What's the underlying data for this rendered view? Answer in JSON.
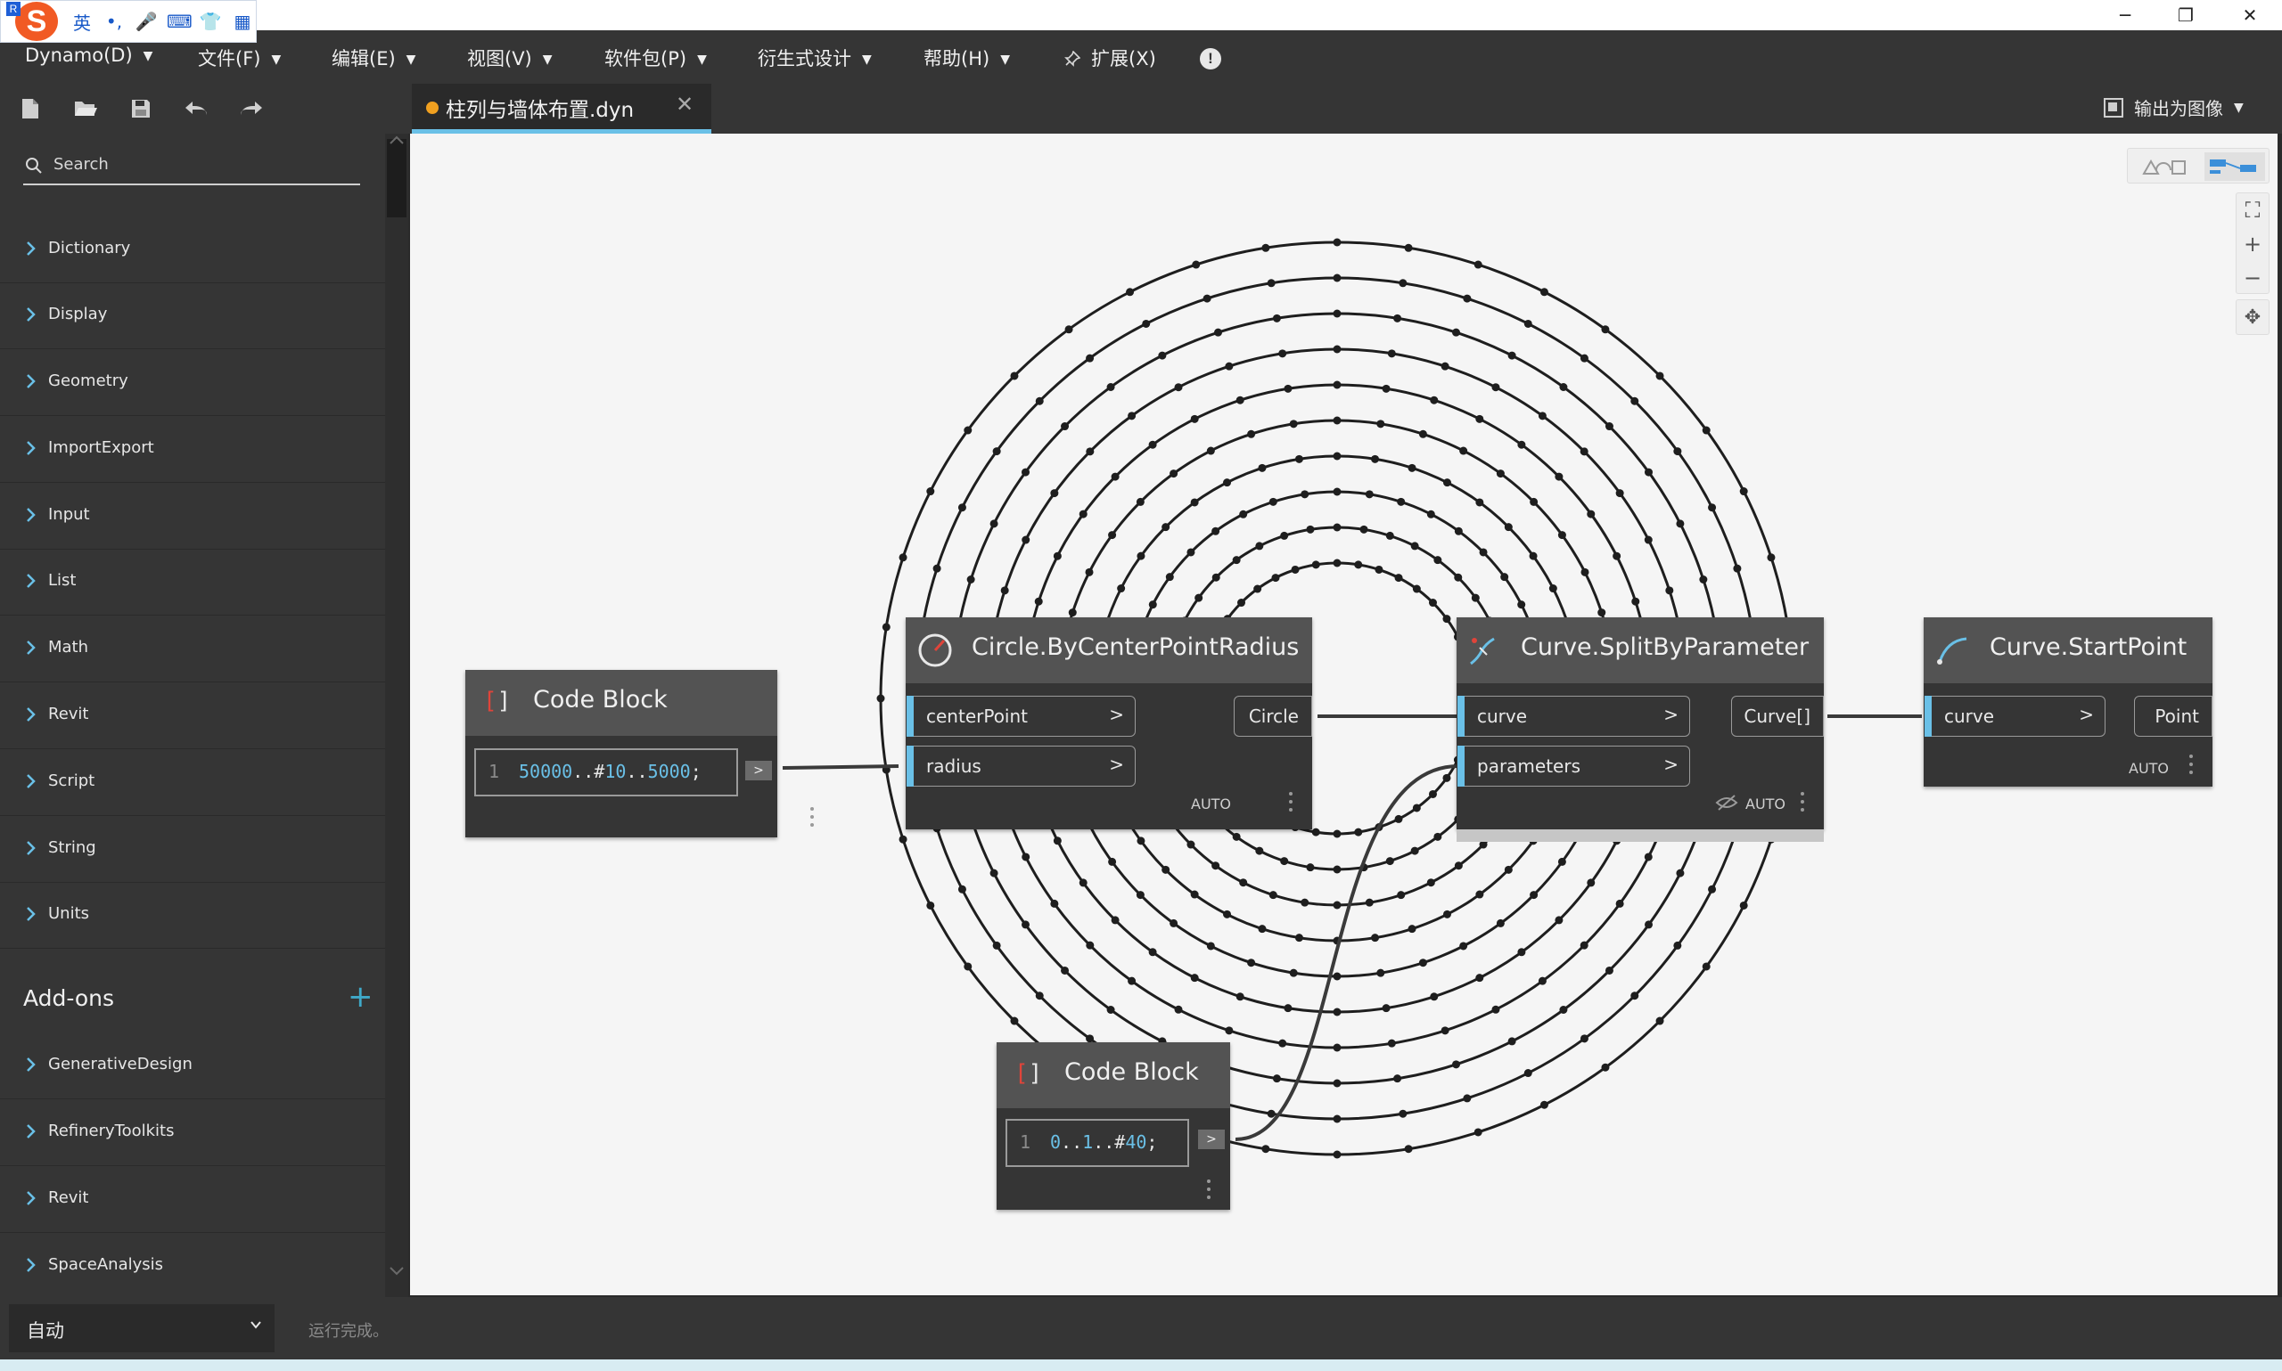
{
  "ime": {
    "logo_letter": "S",
    "badge_letter": "R",
    "tools": [
      "英",
      "•,",
      "🎤",
      "⌨",
      "👕",
      "▦"
    ]
  },
  "window": {
    "minimize": "─",
    "restore": "❐",
    "close": "✕"
  },
  "menu": [
    {
      "label": "Dynamo(D)",
      "caret": "▼"
    },
    {
      "label": "文件(F)",
      "caret": "▼"
    },
    {
      "label": "编辑(E)",
      "caret": "▼"
    },
    {
      "label": "视图(V)",
      "caret": "▼"
    },
    {
      "label": "软件包(P)",
      "caret": "▼"
    },
    {
      "label": "衍生式设计",
      "caret": "▼"
    },
    {
      "label": "帮助(H)",
      "caret": "▼"
    },
    {
      "label": "扩展(X)",
      "caret": ""
    }
  ],
  "help_icon": "!",
  "tab": {
    "label": "柱列与墙体布置.dyn",
    "close": "✕"
  },
  "export": {
    "label": "输出为图像",
    "caret": "▼"
  },
  "library": {
    "search_placeholder": "Search",
    "categories": [
      "Dictionary",
      "Display",
      "Geometry",
      "ImportExport",
      "Input",
      "List",
      "Math",
      "Revit",
      "Script",
      "String",
      "Units"
    ],
    "addons_title": "Add-ons",
    "addons_plus": "+",
    "addons": [
      "GenerativeDesign",
      "RefineryToolkits",
      "Revit",
      "SpaceAnalysis"
    ]
  },
  "zoom": {
    "fit": "⛶",
    "zoom_in": "+",
    "zoom_out": "−",
    "pan": "✥"
  },
  "nodes": {
    "code1": {
      "title": "Code Block",
      "bracket_l": "[",
      "bracket_r": "]",
      "line": "1",
      "code_a": "50000",
      "code_b": "..#",
      "code_c": "10",
      "code_d": "..",
      "code_e": "5000",
      "code_f": ";",
      "out": ">"
    },
    "circle": {
      "title": "Circle.ByCenterPointRadius",
      "in1": "centerPoint",
      "in2": "radius",
      "out": "Circle",
      "gt": ">",
      "auto": "AUTO"
    },
    "split": {
      "title": "Curve.SplitByParameter",
      "in1": "curve",
      "in2": "parameters",
      "out": "Curve[]",
      "gt": ">",
      "auto": "AUTO"
    },
    "start": {
      "title": "Curve.StartPoint",
      "in1": "curve",
      "out": "Point",
      "gt": ">",
      "auto": "AUTO"
    },
    "code2": {
      "title": "Code Block",
      "bracket_l": "[",
      "bracket_r": "]",
      "line": "1",
      "code_a": "0",
      "code_b": "..",
      "code_c": "1",
      "code_d": "..#",
      "code_e": "40",
      "code_f": ";",
      "out": ">"
    }
  },
  "status": {
    "run_mode": "自动",
    "message": "运行完成。"
  }
}
